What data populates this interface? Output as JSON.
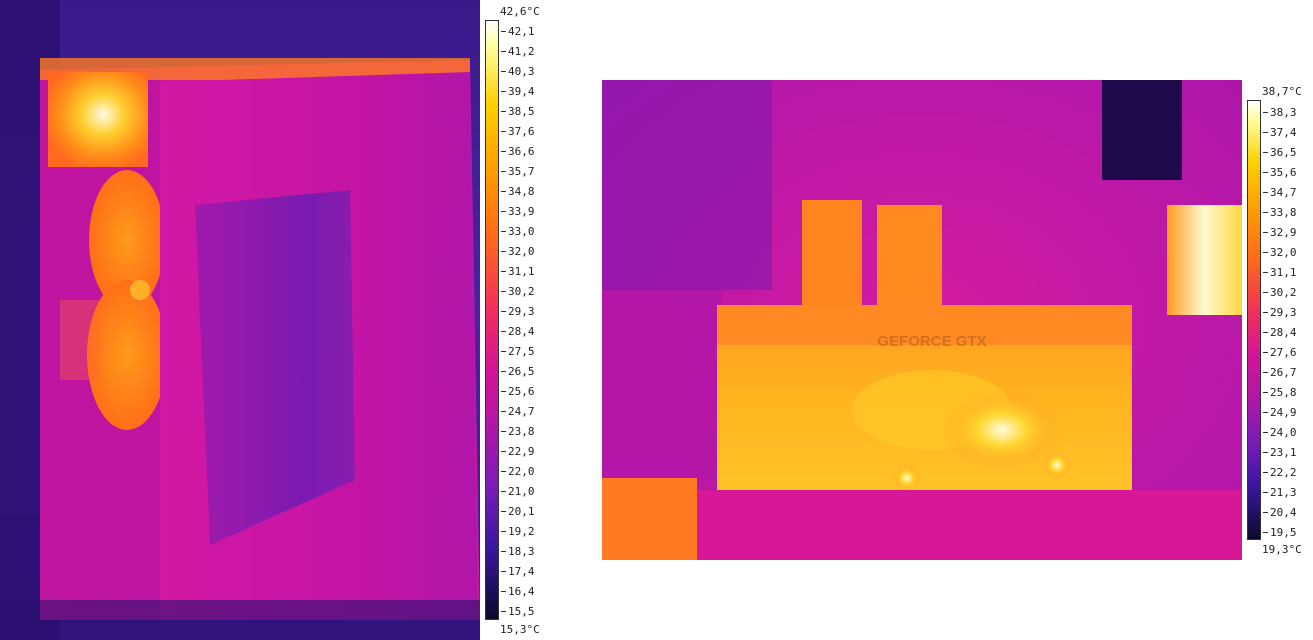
{
  "left_image": {
    "scale_max": "42,6°C",
    "scale_min": "15,3°C",
    "ticks": [
      "42,1",
      "41,2",
      "40,3",
      "39,4",
      "38,5",
      "37,6",
      "36,6",
      "35,7",
      "34,8",
      "33,9",
      "33,0",
      "32,0",
      "31,1",
      "30,2",
      "29,3",
      "28,4",
      "27,5",
      "26,5",
      "25,6",
      "24,7",
      "23,8",
      "22,9",
      "22,0",
      "21,0",
      "20,1",
      "19,2",
      "18,3",
      "17,4",
      "16,4",
      "15,5"
    ]
  },
  "right_image": {
    "scale_max": "38,7°C",
    "scale_min": "19,3°C",
    "ticks": [
      "38,3",
      "37,4",
      "36,5",
      "35,6",
      "34,7",
      "33,8",
      "32,9",
      "32,0",
      "31,1",
      "30,2",
      "29,3",
      "28,4",
      "27,6",
      "26,7",
      "25,8",
      "24,9",
      "24,0",
      "23,1",
      "22,2",
      "21,3",
      "20,4",
      "19,5"
    ],
    "card_text": "GEFORCE GTX"
  },
  "palette": {
    "hot": "#ffffe0",
    "warm": "#ffc400",
    "orange": "#ff7a10",
    "pink": "#e2129a",
    "magenta": "#c8149c",
    "purple": "#7a1ab8",
    "cold": "#1a0a40"
  }
}
